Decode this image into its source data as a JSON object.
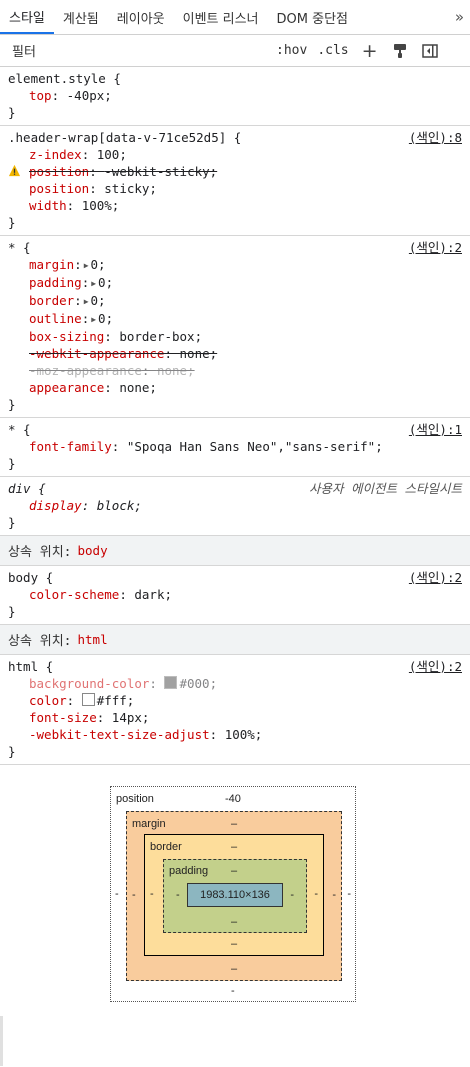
{
  "tabs": [
    "스타일",
    "계산됨",
    "레이아웃",
    "이벤트 리스너",
    "DOM 중단점"
  ],
  "tab_more": "»",
  "toolbar": {
    "filter_placeholder": "필터",
    "hov": ":hov",
    "cls": ".cls",
    "add": "+"
  },
  "rules": {
    "element_style": {
      "selector": "element.style {",
      "decls": [
        {
          "prop": "top",
          "val": "-40px;"
        }
      ]
    },
    "header_wrap": {
      "selector": ".header-wrap[data-v-71ce52d5] {",
      "source": "(색인):8",
      "decls": [
        {
          "prop": "z-index",
          "val": "100;"
        },
        {
          "prop": "position",
          "val": "-webkit-sticky;"
        },
        {
          "prop": "position",
          "val": "sticky;"
        },
        {
          "prop": "width",
          "val": "100%;"
        }
      ]
    },
    "star1": {
      "selector": "* {",
      "source": "(색인):2",
      "decls": [
        {
          "prop": "margin",
          "val": "0;"
        },
        {
          "prop": "padding",
          "val": "0;"
        },
        {
          "prop": "border",
          "val": "0;"
        },
        {
          "prop": "outline",
          "val": "0;"
        },
        {
          "prop": "box-sizing",
          "val": "border-box;"
        },
        {
          "prop": "-webkit-appearance",
          "val": "none;"
        },
        {
          "prop": "-moz-appearance",
          "val": "none;"
        },
        {
          "prop": "appearance",
          "val": "none;"
        }
      ]
    },
    "star2": {
      "selector": "* {",
      "source": "(색인):1",
      "decls": [
        {
          "prop": "font-family",
          "val": "\"Spoqa Han Sans Neo\",\"sans-serif\";"
        }
      ]
    },
    "div": {
      "selector": "div {",
      "source": "사용자 에이전트 스타일시트",
      "decls": [
        {
          "prop": "display",
          "val": "block;"
        }
      ]
    },
    "inherit_body": {
      "label": "상속 위치:",
      "tag": "body"
    },
    "body": {
      "selector": "body {",
      "source": "(색인):2",
      "decls": [
        {
          "prop": "color-scheme",
          "val": "dark;"
        }
      ]
    },
    "inherit_html": {
      "label": "상속 위치:",
      "tag": "html"
    },
    "html": {
      "selector": "html {",
      "source": "(색인):2",
      "decls": [
        {
          "prop": "background-color",
          "val": "#000;"
        },
        {
          "prop": "color",
          "val": "#fff;"
        },
        {
          "prop": "font-size",
          "val": "14px;"
        },
        {
          "prop": "-webkit-text-size-adjust",
          "val": "100%;"
        }
      ]
    },
    "close": "}"
  },
  "colors": {
    "swatch_black": "#555555",
    "swatch_white": "#ffffff"
  },
  "box_model": {
    "position_label": "position",
    "position_value": "-40",
    "margin_label": "margin",
    "border_label": "border",
    "padding_label": "padding",
    "content": "1983.110×136",
    "dash": "-",
    "pos_dash": "–"
  }
}
